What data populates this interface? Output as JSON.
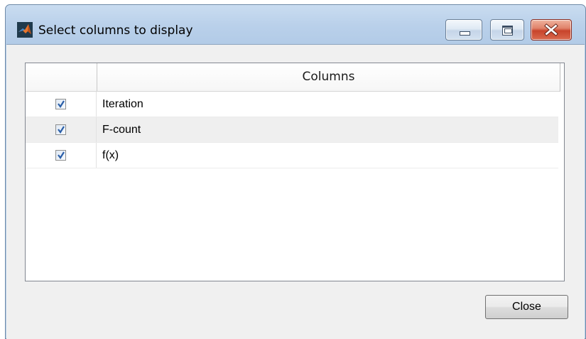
{
  "window": {
    "title": "Select columns to display",
    "app_icon": "matlab-logo-icon",
    "controls": {
      "minimize_icon": "minimize-icon",
      "maximize_icon": "maximize-icon",
      "close_icon": "close-icon"
    }
  },
  "table": {
    "header": {
      "checkbox_column_label": "",
      "columns_label": "Columns"
    },
    "rows": [
      {
        "checked": true,
        "name": "Iteration"
      },
      {
        "checked": true,
        "name": "F-count"
      },
      {
        "checked": true,
        "name": "f(x)"
      }
    ]
  },
  "buttons": {
    "close_label": "Close"
  },
  "colors": {
    "close_button_red": "#c8442b",
    "checkmark_blue": "#2a5ea8",
    "titlebar_blue": "#b9d0ea"
  }
}
